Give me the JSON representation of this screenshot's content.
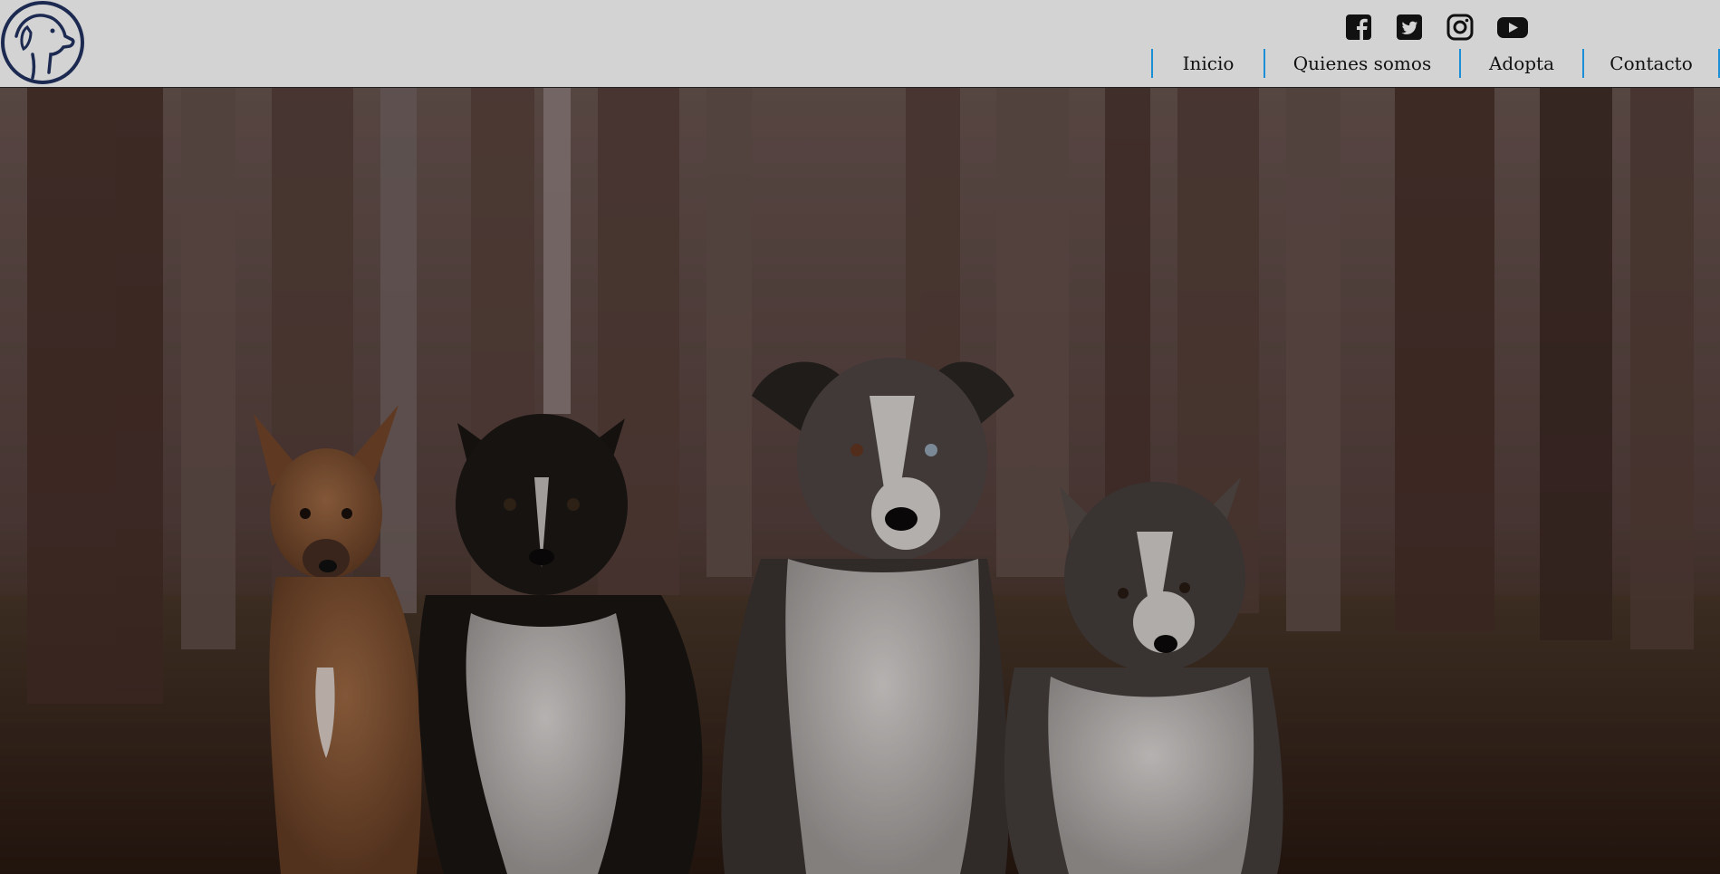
{
  "header": {
    "logo_name": "dog-head-logo",
    "social": [
      {
        "name": "facebook-icon"
      },
      {
        "name": "twitter-icon"
      },
      {
        "name": "instagram-icon"
      },
      {
        "name": "youtube-icon"
      }
    ],
    "nav": {
      "inicio": "Inicio",
      "quienes": "Quienes somos",
      "adopta": "Adopta",
      "contacto": "Contacto"
    }
  },
  "colors": {
    "header_bg": "#d3d3d3",
    "nav_separator": "#1a8fd6",
    "logo_navy": "#1c2a52"
  },
  "hero": {
    "image_description_name": "dogs-in-forest-photo"
  }
}
